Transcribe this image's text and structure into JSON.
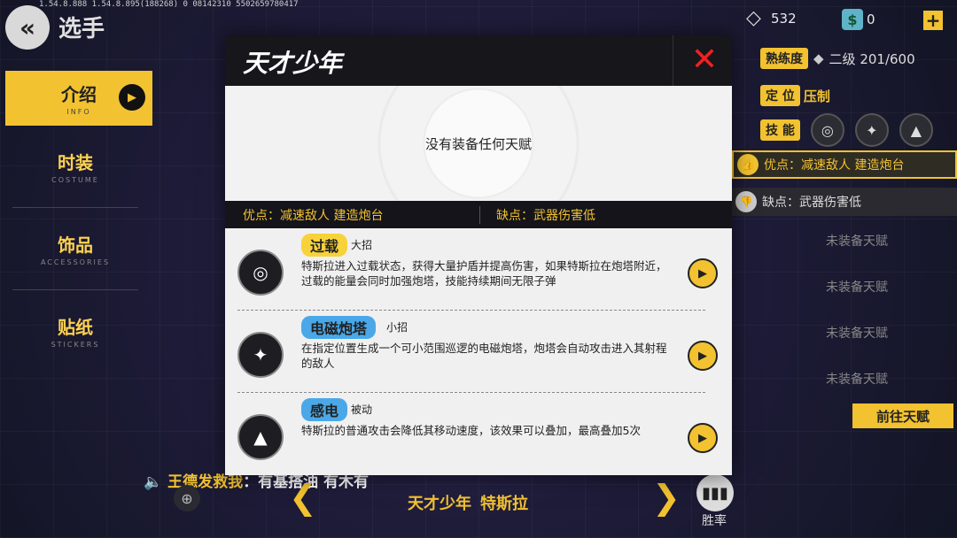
{
  "version": "1.54.8.888 1.54.8.895(188268) 0 08142310 5502659780417",
  "header": {
    "back_icon": "double-chevron-left-icon",
    "title": "选手"
  },
  "sidebar": {
    "items": [
      {
        "label": "介绍",
        "sub": "INFO",
        "active": true
      },
      {
        "label": "时装",
        "sub": "COSTUME"
      },
      {
        "label": "饰品",
        "sub": "ACCESSORIES"
      },
      {
        "label": "贴纸",
        "sub": "STICKERS"
      }
    ]
  },
  "currency": {
    "gems": "532",
    "dollars": "0",
    "plus": "+"
  },
  "right_panel": {
    "proficiency_label": "熟练度",
    "proficiency_value": "二级 201/600",
    "position_label": "定 位",
    "position_value": "压制",
    "skills_label": "技 能",
    "pro_text": "优点：减速敌人 建造炮台",
    "con_text": "缺点：武器伤害低",
    "slots": [
      "未装备天赋",
      "未装备天赋",
      "未装备天赋",
      "未装备天赋"
    ],
    "goto_label": "前往天赋"
  },
  "modal": {
    "title": "天才少年",
    "empty_text": "没有装备任何天赋",
    "pro_text": "优点：减速敌人  建造炮台",
    "con_text": "缺点：武器伤害低",
    "skills": [
      {
        "name": "过载",
        "type": "大招",
        "color": "#f7d23a",
        "desc": "特斯拉进入过载状态，获得大量护盾并提高伤害，如果特斯拉在炮塔附近，过载的能量会同时加强炮塔，技能持续期间无限子弹"
      },
      {
        "name": "电磁炮塔",
        "type": "小招",
        "color": "#4aa8e8",
        "desc": "在指定位置生成一个可小范围巡逻的电磁炮塔，炮塔会自动攻击进入其射程的敌人"
      },
      {
        "name": "感电",
        "type": "被动",
        "color": "#4aa8e8",
        "desc": "特斯拉的普通攻击会降低其移动速度，该效果可以叠加，最高叠加5次"
      }
    ]
  },
  "bottom": {
    "chat_who": "王德发救我",
    "chat_msg": "：有基搭油 有木有",
    "hero_title": "天才少年",
    "hero_name": "特斯拉",
    "win_label": "胜率"
  }
}
